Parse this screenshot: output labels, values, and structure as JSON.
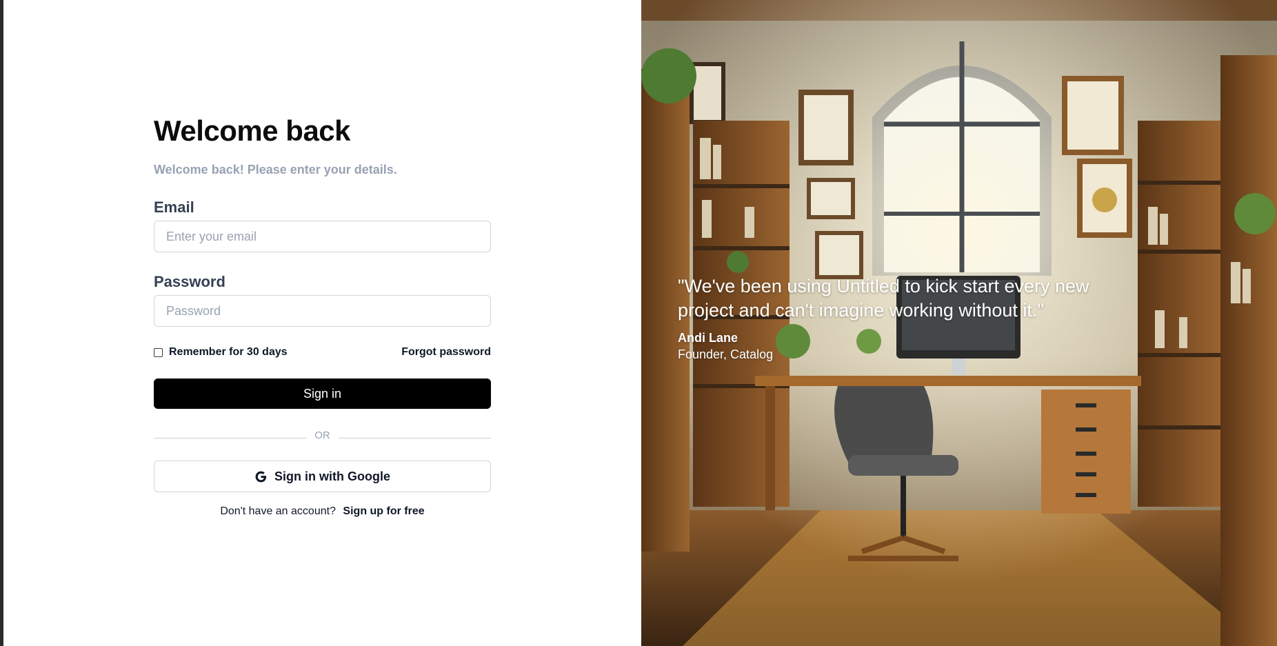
{
  "login": {
    "title": "Welcome back",
    "subtitle": "Welcome back! Please enter your details.",
    "email_label": "Email",
    "email_placeholder": "Enter your email",
    "email_value": "",
    "password_label": "Password",
    "password_placeholder": "Password",
    "password_value": "",
    "remember_label": "Remember for 30 days",
    "remember_checked": false,
    "forgot_label": "Forgot password",
    "sign_in_label": "Sign in",
    "divider_text": "OR",
    "google_label": "Sign in with Google",
    "signup_prompt": "Don't have an account?",
    "signup_link": "Sign up for free"
  },
  "testimonial": {
    "quote": "\"We've been using Untitled to kick start every new project and can't imagine working without it.\"",
    "author": "Andi Lane",
    "role": "Founder, Catalog"
  },
  "icons": {
    "google": "google-icon",
    "checkbox": "checkbox-icon"
  },
  "colors": {
    "primary_button": "#000000",
    "subtitle": "#98a2b3",
    "label": "#344054",
    "border": "#d0d5dd"
  }
}
